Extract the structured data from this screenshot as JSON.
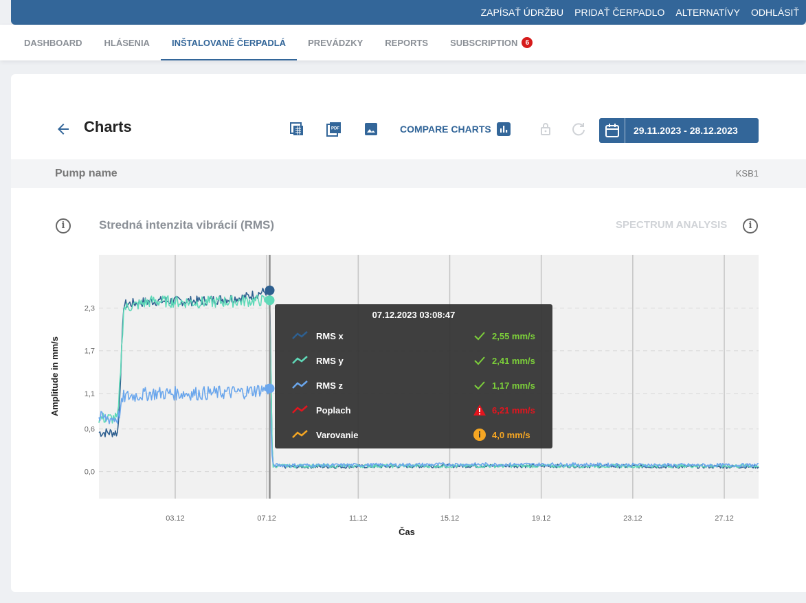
{
  "topbar": {
    "links": [
      "ZAPÍSAŤ ÚDRŽBU",
      "PRIDAŤ ČERPADLO",
      "ALTERNATÍVY",
      "ODHLÁSIŤ"
    ]
  },
  "tabs": {
    "items": [
      {
        "label": "DASHBOARD",
        "active": false
      },
      {
        "label": "HLÁSENIA",
        "active": false
      },
      {
        "label": "INŠTALOVANÉ ČERPADLÁ",
        "active": true
      },
      {
        "label": "PREVÁDZKY",
        "active": false
      },
      {
        "label": "REPORTS",
        "active": false
      },
      {
        "label": "SUBSCRIPTION",
        "active": false,
        "badge": "6"
      }
    ]
  },
  "header": {
    "title": "Charts",
    "compare_label": "COMPARE CHARTS",
    "date_range": "29.11.2023 - 28.12.2023",
    "icons": [
      "back-arrow-icon",
      "table-export-icon",
      "pdf-export-icon",
      "image-export-icon",
      "bar-chart-icon",
      "lock-icon",
      "refresh-icon",
      "calendar-icon"
    ]
  },
  "pump": {
    "label": "Pump name",
    "value": "KSB1"
  },
  "chart_section": {
    "title": "Stredná intenzita vibrácií (RMS)",
    "spectrum_label": "SPECTRUM ANALYSIS"
  },
  "tooltip": {
    "time": "07.12.2023 03:08:47",
    "rows": [
      {
        "name": "RMS x",
        "value": "2,55 mm/s",
        "status": "ok",
        "color": "#2e5f8f",
        "value_color": "#7ccf3a"
      },
      {
        "name": "RMS y",
        "value": "2,41 mm/s",
        "status": "ok",
        "color": "#5fd9b8",
        "value_color": "#7ccf3a"
      },
      {
        "name": "RMS z",
        "value": "1,17 mm/s",
        "status": "ok",
        "color": "#6aa6ec",
        "value_color": "#7ccf3a"
      },
      {
        "name": "Poplach",
        "value": "6,21 mm/s",
        "status": "alarm",
        "color": "#e3151e",
        "value_color": "#e3151e"
      },
      {
        "name": "Varovanie",
        "value": "4,0 mm/s",
        "status": "warning",
        "color": "#f5a623",
        "value_color": "#f5a623"
      }
    ]
  },
  "chart_data": {
    "type": "line",
    "ylabel": "Amplitude in mm/s",
    "xlabel": "Čas",
    "x_ticks": [
      "03.12",
      "07.12",
      "11.12",
      "15.12",
      "19.12",
      "23.12",
      "27.12"
    ],
    "y_ticks": [
      "0,0",
      "0,6",
      "1,1",
      "1,7",
      "2,3"
    ],
    "ylim": [
      -0.38,
      3.05
    ],
    "x_range": [
      "29.11.2023 16:00",
      "28.12.2023 12:00"
    ],
    "grid": true,
    "cursor_x": "07.12.2023 03:08",
    "series": [
      {
        "name": "RMS x",
        "color": "#2e5f8f",
        "x": [
          "29.11.2023",
          "30.11.2023 12:00",
          "30.11.2023 18:00",
          "02.12.2023",
          "04.12.2023",
          "06.12.2023",
          "07.12.2023 03:00",
          "07.12.2023 06:00",
          "10.12.2023",
          "15.12.2023",
          "20.12.2023",
          "25.12.2023",
          "28.12.2023"
        ],
        "y": [
          0.55,
          0.55,
          2.35,
          2.4,
          2.4,
          2.45,
          2.55,
          0.07,
          0.07,
          0.08,
          0.08,
          0.07,
          0.07
        ]
      },
      {
        "name": "RMS y",
        "color": "#5fd9b8",
        "x": [
          "29.11.2023",
          "30.11.2023 12:00",
          "30.11.2023 18:00",
          "02.12.2023",
          "04.12.2023",
          "06.12.2023",
          "07.12.2023 03:00",
          "07.12.2023 06:00",
          "10.12.2023",
          "15.12.2023",
          "20.12.2023",
          "25.12.2023",
          "28.12.2023"
        ],
        "y": [
          0.75,
          0.75,
          2.3,
          2.4,
          2.38,
          2.4,
          2.41,
          0.08,
          0.08,
          0.08,
          0.08,
          0.08,
          0.08
        ]
      },
      {
        "name": "RMS z",
        "color": "#6aa6ec",
        "x": [
          "29.11.2023",
          "30.11.2023 12:00",
          "30.11.2023 18:00",
          "02.12.2023",
          "04.12.2023",
          "06.12.2023",
          "07.12.2023 03:00",
          "07.12.2023 06:00",
          "10.12.2023",
          "15.12.2023",
          "20.12.2023",
          "25.12.2023",
          "28.12.2023"
        ],
        "y": [
          0.75,
          0.75,
          1.05,
          1.1,
          1.1,
          1.12,
          1.17,
          0.09,
          0.09,
          0.1,
          0.1,
          0.09,
          0.09
        ]
      }
    ]
  }
}
